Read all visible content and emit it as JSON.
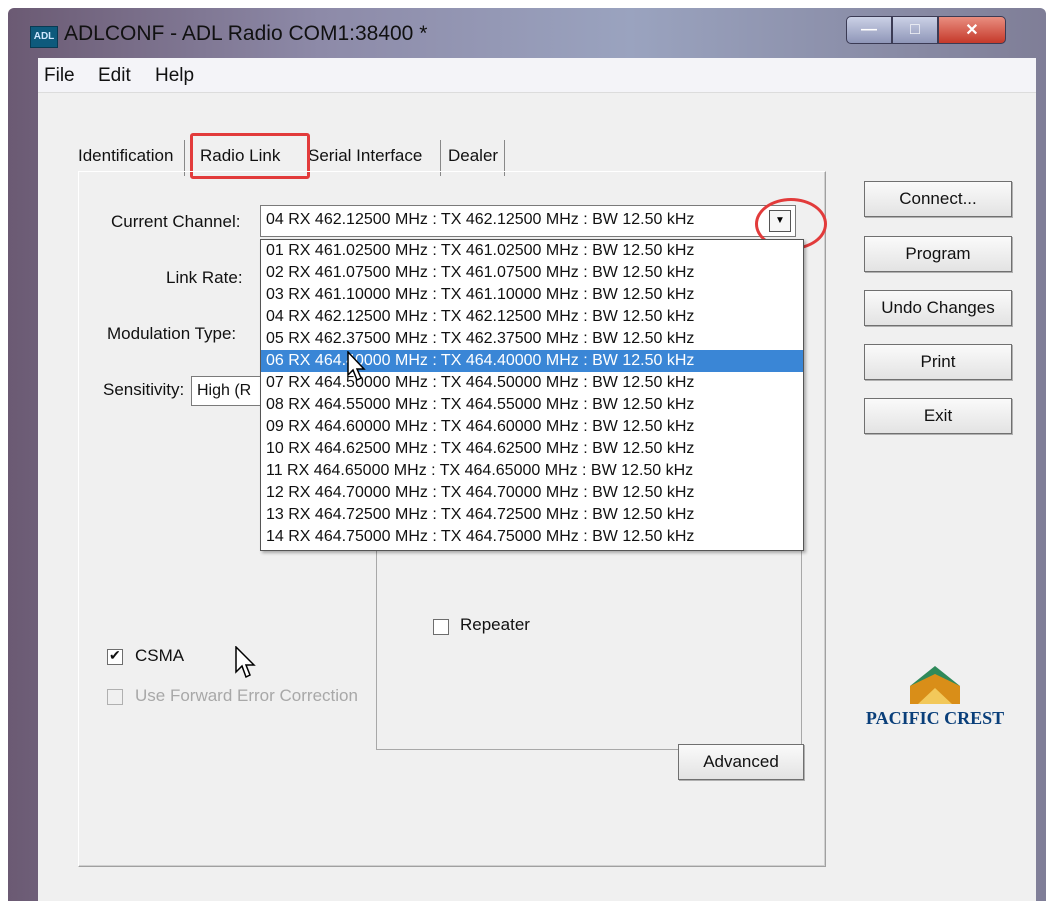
{
  "window": {
    "app_icon": "ADL",
    "title": "ADLCONF - ADL Radio COM1:38400 *"
  },
  "menu": [
    "File",
    "Edit",
    "Help"
  ],
  "tabs": [
    "Identification",
    "Radio Link",
    "Serial Interface",
    "Dealer"
  ],
  "active_tab": "Radio Link",
  "form": {
    "current_channel_label": "Current Channel:",
    "current_channel_value": "04  RX 462.12500 MHz : TX 462.12500 MHz : BW 12.50 kHz",
    "link_rate_label": "Link Rate:",
    "modulation_type_label": "Modulation Type:",
    "sensitivity_label": "Sensitivity:",
    "sensitivity_value": "High (R"
  },
  "channel_options": [
    "01  RX 461.02500 MHz : TX 461.02500 MHz : BW 12.50 kHz",
    "02  RX 461.07500 MHz : TX 461.07500 MHz : BW 12.50 kHz",
    "03  RX 461.10000 MHz : TX 461.10000 MHz : BW 12.50 kHz",
    "04  RX 462.12500 MHz : TX 462.12500 MHz : BW 12.50 kHz",
    "05  RX 462.37500 MHz : TX 462.37500 MHz : BW 12.50 kHz",
    "06  RX 464.40000 MHz : TX 464.40000 MHz : BW 12.50 kHz",
    "07  RX 464.50000 MHz : TX 464.50000 MHz : BW 12.50 kHz",
    "08  RX 464.55000 MHz : TX 464.55000 MHz : BW 12.50 kHz",
    "09  RX 464.60000 MHz : TX 464.60000 MHz : BW 12.50 kHz",
    "10  RX 464.62500 MHz : TX 464.62500 MHz : BW 12.50 kHz",
    "11  RX 464.65000 MHz : TX 464.65000 MHz : BW 12.50 kHz",
    "12  RX 464.70000 MHz : TX 464.70000 MHz : BW 12.50 kHz",
    "13  RX 464.72500 MHz : TX 464.72500 MHz : BW 12.50 kHz",
    "14  RX 464.75000 MHz : TX 464.75000 MHz : BW 12.50 kHz"
  ],
  "highlighted_option_index": 5,
  "checkboxes": {
    "csma": {
      "label": "CSMA",
      "checked": true
    },
    "fec": {
      "label": "Use Forward Error Correction",
      "checked": false,
      "disabled": true
    },
    "repeater": {
      "label": "Repeater",
      "checked": false
    }
  },
  "buttons": {
    "connect": "Connect...",
    "program": "Program",
    "undo": "Undo Changes",
    "print": "Print",
    "exit": "Exit",
    "advanced": "Advanced"
  },
  "logo": {
    "text": "PACIFIC CREST"
  },
  "colors": {
    "highlight": "#3a86d6",
    "annotation_red": "#e23b3b",
    "logo_green": "#2f8a5a",
    "logo_blue": "#0a3f7a"
  }
}
